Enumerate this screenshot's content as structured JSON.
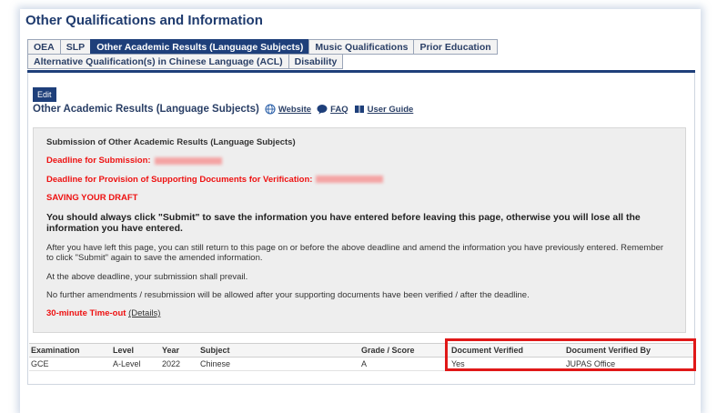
{
  "page_title": "Other Qualifications and Information",
  "tabs": [
    {
      "label": "OEA",
      "active": false
    },
    {
      "label": "SLP",
      "active": false
    },
    {
      "label": "Other Academic Results (Language Subjects)",
      "active": true
    },
    {
      "label": "Music Qualifications",
      "active": false
    },
    {
      "label": "Prior Education",
      "active": false
    },
    {
      "label": "Alternative Qualification(s) in Chinese Language (ACL)",
      "active": false
    },
    {
      "label": "Disability",
      "active": false
    }
  ],
  "edit_label": "Edit",
  "section": {
    "title": "Other Academic Results (Language Subjects)",
    "website_label": "Website",
    "faq_label": "FAQ",
    "guide_label": "User Guide"
  },
  "notice": {
    "heading": "Submission of Other Academic Results (Language Subjects)",
    "deadline_submission": "Deadline for Submission:",
    "deadline_docs": "Deadline for Provision of Supporting Documents for Verification:",
    "saving_title": "SAVING YOUR DRAFT",
    "saving_text": "You should always click \"Submit\" to save the information you have entered before leaving this page, otherwise you will lose all the information you have entered.",
    "para1": "After you have left this page, you can still return to this page on or before the above deadline and amend the information you have previously entered. Remember to click \"Submit\" again to save the amended information.",
    "para2": "At the above deadline, your submission shall prevail.",
    "para3": "No further amendments / resubmission will be allowed after your supporting documents have been verified / after the deadline.",
    "timeout_label": "30-minute Time-out",
    "details_label": "(Details)"
  },
  "table": {
    "headers": [
      "Examination",
      "Level",
      "Year",
      "Subject",
      "Grade / Score",
      "Document Verified",
      "Document Verified By"
    ],
    "rows": [
      [
        "GCE",
        "A-Level",
        "2022",
        "Chinese",
        "A",
        "Yes",
        "JUPAS Office"
      ]
    ]
  },
  "colors": {
    "accent": "#1e3f7a",
    "warning": "#e11111",
    "highlight": "#e01818"
  }
}
